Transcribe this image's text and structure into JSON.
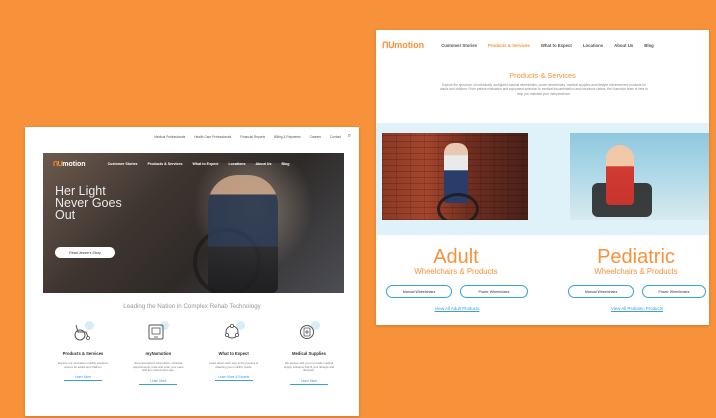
{
  "left_page": {
    "utility_links": [
      "Medical Professionals",
      "Health Care Professionals",
      "Financial Reports",
      "Billing & Payments",
      "Careers",
      "Contact"
    ],
    "nav_items": [
      "Customer Stories",
      "Products & Services",
      "What to Expect",
      "Locations",
      "About Us",
      "Blog"
    ],
    "logo_mark": "ᑎᑌ",
    "logo_word": "motion",
    "hero_headline": "Her Light Never Goes Out",
    "hero_button": "Read Jessie's Story",
    "tagline": "Leading the Nation in Complex Rehab Technology",
    "features": [
      {
        "title": "Products & Services",
        "description": "Explore our innovative mobility solutions options for adults and children.",
        "link": "Learn More",
        "icon": "wheelchair-icon"
      },
      {
        "title": "myNumotion",
        "description": "Get prescriptions information, schedule appointments, track and order your parts with the myNumotion app.",
        "link": "Learn More",
        "icon": "tablet-icon"
      },
      {
        "title": "What to Expect",
        "description": "Learn about each step in the process of obtaining your mobility needs.",
        "link": "Learn More & Experts",
        "icon": "process-icon"
      },
      {
        "title": "Medical Supplies",
        "description": "We partner with you to provide medical supply solutions that fit your lifestyle and lifestyles.",
        "link": "Learn More",
        "icon": "medical-icon"
      }
    ]
  },
  "right_page": {
    "logo_mark": "ᑎᑌ",
    "logo_word": "motion",
    "nav_items": [
      "Customer Stories",
      "Products & Services",
      "What to Expect",
      "Locations",
      "About Us",
      "Blog"
    ],
    "active_nav": "Products & Services",
    "page_title": "Products & Services",
    "intro": "Explore the spectrum of individually configured manual wheelchairs, power wheelchairs, medical supplies and lifestyle enhancement products for adults and children. From patient evaluation and equipment selection to medical documentation and insurance claims, the Numotion team is here to help you maintain your independence.",
    "categories": [
      {
        "title": "Adult",
        "subtitle": "Wheelchairs & Products",
        "buttons": [
          "Manual Wheelchairs",
          "Power Wheelchairs"
        ],
        "view_all": "View All Adult Products"
      },
      {
        "title": "Pediatric",
        "subtitle": "Wheelchairs & Products",
        "buttons": [
          "Manual Wheelchairs",
          "Power Wheelchairs"
        ],
        "view_all": "View All Pediatric Products"
      }
    ]
  },
  "colors": {
    "background": "#F7923A",
    "accent": "#F7923A",
    "link": "#3AA0D8",
    "band": "#DFF2FA"
  }
}
